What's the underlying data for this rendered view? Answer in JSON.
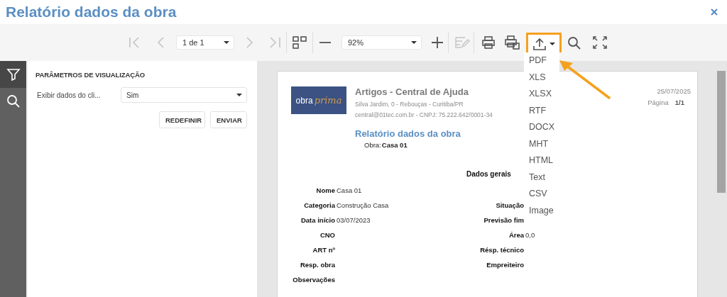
{
  "window": {
    "title": "Relatório dados da obra"
  },
  "toolbar": {
    "items": [
      {
        "kind": "first",
        "disabled": true
      },
      {
        "kind": "prev",
        "disabled": true
      },
      {
        "kind": "page-select",
        "value": "1 de 1"
      },
      {
        "kind": "next",
        "disabled": true
      },
      {
        "kind": "last",
        "disabled": true
      },
      {
        "kind": "multipage",
        "disabled": false
      },
      {
        "kind": "zoom-out",
        "disabled": false
      },
      {
        "kind": "zoom-select",
        "value": "92%"
      },
      {
        "kind": "zoom-in",
        "disabled": false
      },
      {
        "kind": "edit",
        "disabled": true
      },
      {
        "kind": "print",
        "disabled": false
      },
      {
        "kind": "print-page",
        "disabled": false
      },
      {
        "kind": "export",
        "expanded": true
      },
      {
        "kind": "search",
        "disabled": false
      },
      {
        "kind": "fullscreen",
        "disabled": false
      }
    ]
  },
  "export_menu": {
    "items": [
      "PDF",
      "XLS",
      "XLSX",
      "RTF",
      "DOCX",
      "MHT",
      "HTML",
      "Text",
      "CSV",
      "Image"
    ]
  },
  "sidebar_tabs": [
    {
      "kind": "filter",
      "selected": true
    },
    {
      "kind": "search",
      "selected": false
    }
  ],
  "parameters": {
    "heading": "PARÂMETROS DE VISUALIZAÇÃO",
    "fields": [
      {
        "label": "Exibir dados do cli...",
        "value": "Sim"
      }
    ],
    "buttons": [
      "REDEFINIR",
      "ENVIAR"
    ]
  },
  "report": {
    "logo": {
      "word_1": "obra",
      "word_2": "prima"
    },
    "company": "Artigos - Central de Ajuda",
    "address": "Silva Jardim, 0 - Rebouças - Curitiba/PR",
    "contact": "central@01tec.com.br - CNPJ: 75.222.642/0001-34",
    "date": "25/07/2025",
    "page_label": "Página",
    "page_value": "1/1",
    "title": "Relatório dados da obra",
    "obra_label": "Obra:",
    "obra_value": "Casa 01",
    "section": "Dados gerais",
    "rows": [
      {
        "left": {
          "label": "Nome",
          "value": "Casa 01"
        }
      },
      {
        "left": {
          "label": "Categoria",
          "value": "Construção Casa"
        },
        "right": {
          "label": "Situação"
        }
      },
      {
        "left": {
          "label": "Data início",
          "value": "03/07/2023"
        },
        "right": {
          "label": "Previsão fim"
        }
      },
      {
        "left": {
          "label": "CNO"
        },
        "right": {
          "label": "Área",
          "value": "0,0"
        }
      },
      {
        "left": {
          "label": "ART nº"
        },
        "right": {
          "label": "Résp. técnico"
        }
      },
      {
        "left": {
          "label": "Resp. obra"
        },
        "right": {
          "label": "Empreiteiro"
        }
      },
      {
        "left": {
          "label": "Observações"
        }
      }
    ]
  },
  "annotations": {
    "highlight_frame": true,
    "pointer_arrow": true
  }
}
